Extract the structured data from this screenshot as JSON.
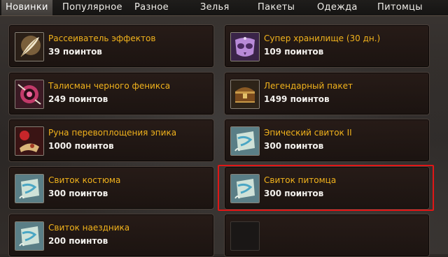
{
  "tabs": [
    {
      "label": "Новинки",
      "active": true
    },
    {
      "label": "Популярное"
    },
    {
      "label": "Разное"
    },
    {
      "label": "Зелья"
    },
    {
      "label": "Пакеты"
    },
    {
      "label": "Одежда"
    },
    {
      "label": "Питомцы"
    }
  ],
  "items": [
    {
      "name": "Рассеиватель эффектов",
      "points": "39 поинтов",
      "icon": "feather-icon"
    },
    {
      "name": "Супер хранилище (30 дн.)",
      "points": "109 поинтов",
      "icon": "chest-mask-icon"
    },
    {
      "name": "Талисман черного феникса",
      "points": "249 поинтов",
      "icon": "talisman-icon"
    },
    {
      "name": "Легендарный пакет",
      "points": "1499 поинтов",
      "icon": "treasure-chest-icon"
    },
    {
      "name": "Руна перевоплощения эпика",
      "points": "1000 поинтов",
      "icon": "rune-icon"
    },
    {
      "name": "Эпический свиток II",
      "points": "300 поинтов",
      "icon": "scroll-icon"
    },
    {
      "name": "Свиток костюма",
      "points": "300 поинтов",
      "icon": "scroll-icon"
    },
    {
      "name": "Свиток питомца",
      "points": "300 поинтов",
      "icon": "scroll-icon",
      "highlighted": true
    },
    {
      "name": "Свиток наездника",
      "points": "200 поинтов",
      "icon": "scroll-icon"
    },
    {
      "name": "",
      "points": "",
      "icon": "empty-slot"
    }
  ],
  "colors": {
    "item_name": "#f2b31c",
    "highlight": "#e01616"
  }
}
